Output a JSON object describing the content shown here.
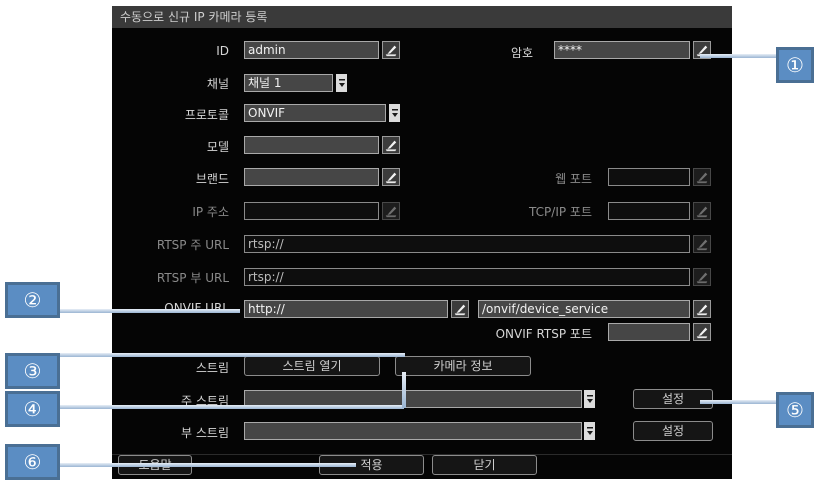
{
  "dialog": {
    "title": "수동으로 신규 IP 카메라 등록",
    "labels": {
      "id": "ID",
      "password": "암호",
      "channel": "채널",
      "protocol": "프로토콜",
      "model": "모델",
      "brand": "브랜드",
      "web_port": "웹 포트",
      "ip_address": "IP 주소",
      "tcp_port": "TCP/IP 포트",
      "rtsp_main_url": "RTSP 주 URL",
      "rtsp_sub_url": "RTSP 부 URL",
      "onvif_url": "ONVIF URL",
      "onvif_rtsp_port": "ONVIF RTSP 포트",
      "stream": "스트림",
      "main_stream": "주 스트림",
      "sub_stream": "부 스트림"
    },
    "values": {
      "id": "admin",
      "password": "****",
      "channel": "채널 1",
      "protocol": "ONVIF",
      "model": "",
      "brand": "",
      "web_port": "",
      "ip_address": "",
      "tcp_port": "",
      "rtsp_main_url": "rtsp://",
      "rtsp_sub_url": "rtsp://",
      "onvif_url": "http://",
      "onvif_path": "/onvif/device_service",
      "onvif_rtsp_port": "",
      "main_stream": "",
      "sub_stream": ""
    },
    "buttons": {
      "open_stream": "스트림 열기",
      "camera_info": "카메라 정보",
      "setup_main": "설정",
      "setup_sub": "설정",
      "help": "도움말",
      "apply": "적용",
      "close": "닫기"
    }
  },
  "callouts": {
    "c1": "①",
    "c2": "②",
    "c3": "③",
    "c4": "④",
    "c5": "⑤",
    "c6": "⑥"
  },
  "colors": {
    "dialog_bg": "#050505",
    "titlebar_bg": "#3a3a3a",
    "field_bg": "#464646",
    "callout_fill": "#5b8dc3",
    "callout_border": "#4a6f94"
  },
  "icons": {
    "edit": "pencil-keyboard-icon",
    "dropdown": "chevron-down-icon"
  }
}
